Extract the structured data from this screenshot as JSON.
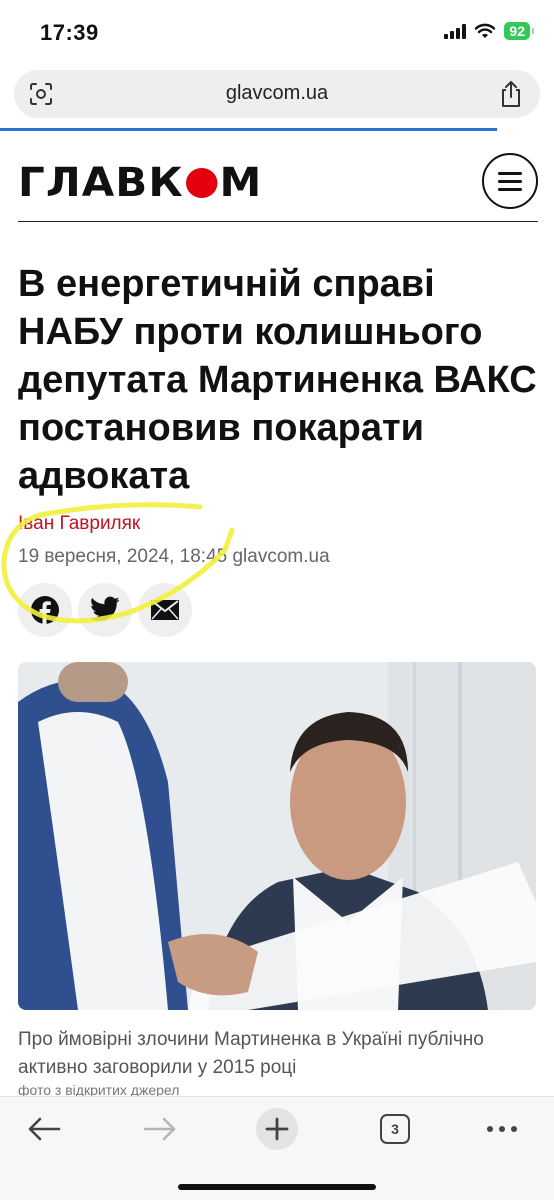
{
  "status_bar": {
    "time": "17:39",
    "battery": "92"
  },
  "browser": {
    "url": "glavcom.ua",
    "tabs_count": "3"
  },
  "site": {
    "logo_left": "ГЛАВК",
    "logo_right": "М"
  },
  "article": {
    "title": "В енергетичній справі НАБУ проти колишнього депутата Мартиненка ВАКС постановив покарати адвоката",
    "author": "Іван Гавриляк",
    "meta": "19 вересня, 2024, 18:45 glavcom.ua",
    "caption": "Про ймовірні злочини Мартиненка в Україні публічно активно заговорили у 2015 році",
    "photo_credit": "фото з відкритих джерел"
  },
  "share": [
    "facebook-icon",
    "twitter-icon",
    "mail-icon"
  ],
  "colors": {
    "accent": "#e3000f",
    "author": "#c1121f",
    "progress": "#2c6ed5",
    "highlight": "#f2ef3b"
  }
}
